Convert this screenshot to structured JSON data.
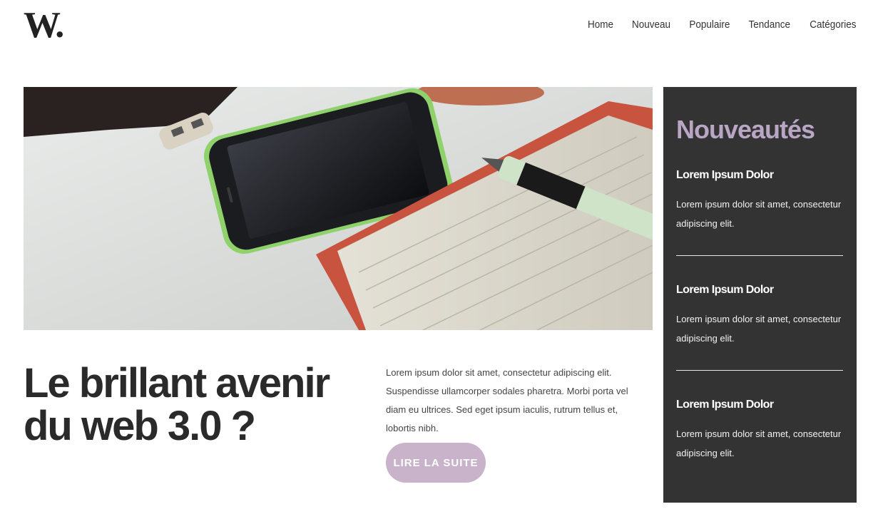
{
  "header": {
    "logo": "W.",
    "nav": [
      "Home",
      "Nouveau",
      "Populaire",
      "Tendance",
      "Catégories"
    ]
  },
  "article": {
    "title": "Le brillant avenir du web 3.0 ?",
    "excerpt": "Lorem ipsum dolor sit amet, consectetur adipiscing elit. Suspendisse ullamcorper sodales pharetra. Morbi porta vel diam eu ultrices. Sed eget ipsum iaculis, rutrum tellus et, lobortis nibh.",
    "cta_label": "LIRE LA SUITE"
  },
  "sidebar": {
    "title": "Nouveautés",
    "items": [
      {
        "title": "Lorem Ipsum Dolor",
        "text": "Lorem ipsum dolor sit amet, consectetur adipiscing elit."
      },
      {
        "title": "Lorem Ipsum Dolor",
        "text": "Lorem ipsum dolor sit amet, consectetur adipiscing elit."
      },
      {
        "title": "Lorem Ipsum Dolor",
        "text": "Lorem ipsum dolor sit amet, consectetur adipiscing elit."
      }
    ]
  },
  "colors": {
    "accent": "#c8b3cb",
    "sidebar_bg": "#333333",
    "sidebar_title": "#b9a6c4",
    "text_dark": "#2a2a2a"
  }
}
